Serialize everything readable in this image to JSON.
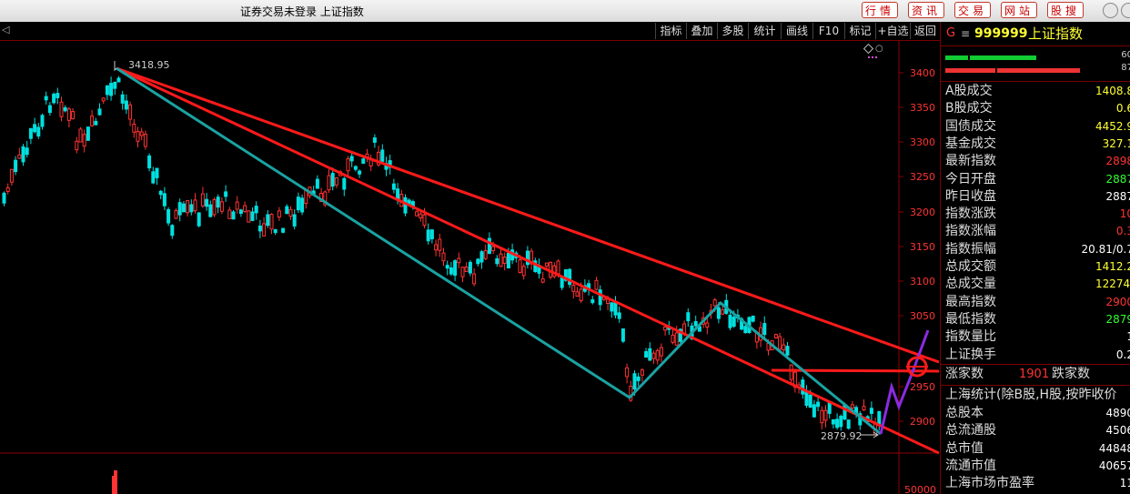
{
  "window": {
    "title": "证券交易未登录 上证指数",
    "nav_buttons": [
      "行情",
      "资讯",
      "交易",
      "网站",
      "股搜"
    ]
  },
  "toolbar": {
    "arrow": "◁",
    "items": [
      "指标",
      "叠加",
      "多股",
      "统计",
      "画线",
      "F10",
      "标记",
      "+自选",
      "返回"
    ]
  },
  "chart": {
    "y_ticks": [
      "3400",
      "3350",
      "3300",
      "3250",
      "3200",
      "3150",
      "3100",
      "3050",
      "2950",
      "2900"
    ],
    "volume_tick": "50000",
    "high_label": "3418.95",
    "low_label": "2879.92",
    "colors": {
      "up": "#ff3333",
      "down": "#00e0e0",
      "trend": "#ff1a1a",
      "zigzag": "#1aa3a3",
      "projection": "#8a2be2"
    }
  },
  "sidebar": {
    "header_g": "G",
    "header_menu": "≡",
    "code": "999999",
    "name": "上证指数",
    "bar_value_1": "60",
    "bar_value_2": "87",
    "rows": [
      {
        "label": "A股成交",
        "value": "1408.8",
        "color": "#ffff33"
      },
      {
        "label": "B股成交",
        "value": "0.6",
        "color": "#ffff33"
      },
      {
        "label": "国债成交",
        "value": "4452.9",
        "color": "#ffff33"
      },
      {
        "label": "基金成交",
        "value": "327.1",
        "color": "#ffff33"
      },
      {
        "label": "最新指数",
        "value": "2898",
        "color": "#ff3333"
      },
      {
        "label": "今日开盘",
        "value": "2887",
        "color": "#33ff33"
      },
      {
        "label": "昨日收盘",
        "value": "2887",
        "color": "#ffffff"
      },
      {
        "label": "指数涨跌",
        "value": "10",
        "color": "#ff3333"
      },
      {
        "label": "指数涨幅",
        "value": "0.3",
        "color": "#ff3333"
      },
      {
        "label": "指数振幅",
        "value": "20.81/0.7",
        "color": "#ffffff"
      },
      {
        "label": "总成交额",
        "value": "1412.2",
        "color": "#ffff33"
      },
      {
        "label": "总成交量",
        "value": "12274.",
        "color": "#ffff33"
      },
      {
        "label": "最高指数",
        "value": "2900",
        "color": "#ff3333"
      },
      {
        "label": "最低指数",
        "value": "2879",
        "color": "#33ff33"
      },
      {
        "label": "指数量比",
        "value": "1",
        "color": "#ffffff"
      },
      {
        "label": "上证换手",
        "value": "0.2",
        "color": "#ffffff"
      }
    ],
    "rise_label": "涨家数",
    "rise_value": "1901",
    "fall_label": "跌家数",
    "stats_title": "上海统计(除B股,H股,按昨收价",
    "stats_rows": [
      {
        "label": "总股本",
        "value": "4890"
      },
      {
        "label": "总流通股",
        "value": "4506"
      },
      {
        "label": "总市值",
        "value": "44848"
      },
      {
        "label": "流通市值",
        "value": "40657"
      },
      {
        "label": "上海市场市盈率",
        "value": "11"
      }
    ]
  }
}
